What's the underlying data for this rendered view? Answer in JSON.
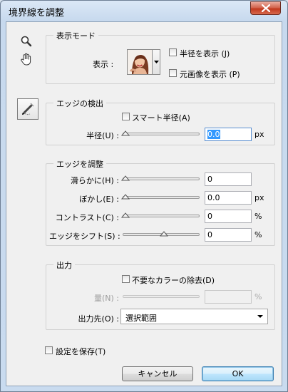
{
  "window": {
    "title": "境界線を調整"
  },
  "tools": [
    "zoom-tool-icon",
    "hand-tool-icon",
    "refine-radius-brush-icon"
  ],
  "view_mode": {
    "title": "表示モード",
    "view_label": "表示 :",
    "show_radius_label": "半径を表示 (J)",
    "show_radius_checked": false,
    "show_original_label": "元画像を表示 (P)",
    "show_original_checked": false
  },
  "edge_detection": {
    "title": "エッジの検出",
    "smart_radius_label": "スマート半径(A)",
    "smart_radius_checked": false,
    "radius_label": "半径(U) :",
    "radius_value": "0.0",
    "radius_unit": "px",
    "radius_slider": 0
  },
  "adjust_edge": {
    "title": "エッジを調整",
    "smooth_label": "滑らかに(H) :",
    "smooth_value": "0",
    "smooth_slider": 0,
    "feather_label": "ぼかし(E) :",
    "feather_value": "0.0",
    "feather_unit": "px",
    "feather_slider": 0,
    "contrast_label": "コントラスト(C) :",
    "contrast_value": "0",
    "contrast_unit": "%",
    "contrast_slider": 0,
    "shift_label": "エッジをシフト(S) :",
    "shift_value": "0",
    "shift_unit": "%",
    "shift_slider": 0.5
  },
  "output": {
    "title": "出力",
    "decontaminate_label": "不要なカラーの除去(D)",
    "decontaminate_checked": false,
    "amount_label": "量(N) :",
    "amount_value": "",
    "amount_unit": "%",
    "output_to_label": "出力先(O) :",
    "output_to_value": "選択範囲"
  },
  "remember_label": "設定を保存(T)",
  "remember_checked": false,
  "cancel_label": "キャンセル",
  "ok_label": "OK",
  "colors": {
    "accent": "#3399ff",
    "close": "#c1391e",
    "panel": "#f0f0f0"
  }
}
